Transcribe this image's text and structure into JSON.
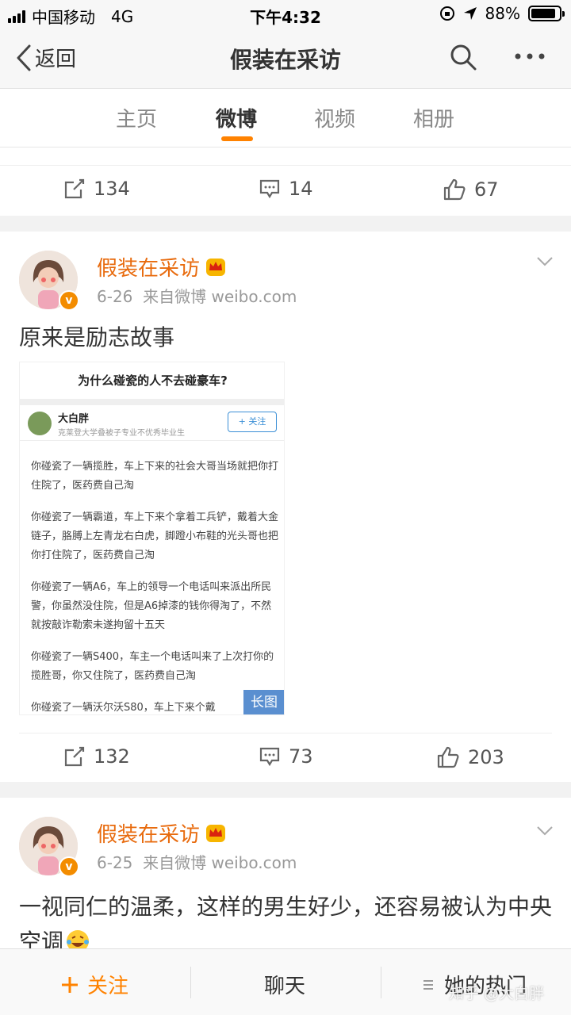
{
  "status_bar": {
    "carrier": "中国移动",
    "network": "4G",
    "time": "下午4:32",
    "battery": "88%",
    "battery_level": 0.88
  },
  "nav": {
    "back_label": "返回",
    "title": "假装在采访"
  },
  "tabs": [
    {
      "label": "主页"
    },
    {
      "label": "微博"
    },
    {
      "label": "视频"
    },
    {
      "label": "相册"
    }
  ],
  "active_tab": "微博",
  "previous_post": {
    "reposts": "134",
    "comments": "14",
    "likes": "67"
  },
  "posts": [
    {
      "username": "假装在采访",
      "date": "6-26",
      "source": "来自微博 weibo.com",
      "text": "原来是励志故事",
      "long_image": {
        "question": "为什么碰瓷的人不去碰豪车?",
        "author": "大白胖",
        "author_desc": "克莱登大学叠被子专业不优秀毕业生",
        "follow_label": "+ 关注",
        "paragraphs": [
          "你碰瓷了一辆揽胜，车上下来的社会大哥当场就把你打住院了，医药费自己淘",
          "你碰瓷了一辆霸道，车上下来个拿着工兵铲，戴着大金链子，胳膊上左青龙右白虎，脚蹬小布鞋的光头哥也把你打住院了，医药费自己淘",
          "你碰瓷了一辆A6，车上的领导一个电话叫来派出所民警，你虽然没住院，但是A6掉漆的钱你得淘了，不然就按敲诈勒索未遂拘留十五天",
          "你碰瓷了一辆S400，车主一个电话叫来了上次打你的揽胜哥，你又住院了，医药费自己淘",
          "你碰瓷了一辆沃尔沃S80，车上下来个戴"
        ],
        "badge": "长图"
      },
      "reposts": "132",
      "comments": "73",
      "likes": "203"
    },
    {
      "username": "假装在采访",
      "date": "6-25",
      "source": "来自微博 weibo.com",
      "text": "一视同仁的温柔，这样的男生好少，还容易被认为中央空调"
    }
  ],
  "bottom_bar": {
    "follow_label": "关注",
    "chat_label": "聊天",
    "hot_label": "她的热门"
  },
  "watermark": "知乎 @大白胖",
  "colors": {
    "accent": "#ff8200",
    "username": "#e86b0e",
    "badge_blue": "#5a8fd0"
  }
}
